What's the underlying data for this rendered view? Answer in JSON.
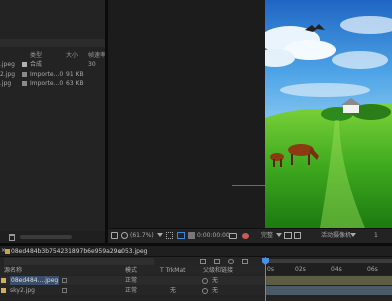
{
  "project": {
    "columns": {
      "type": "类型",
      "size": "大小",
      "depth": "帧速率"
    },
    "items": [
      {
        "name": ".jpeg",
        "type": "合成",
        "size": "",
        "depth": "30"
      },
      {
        "name": "2.jpg",
        "type": "Importe...0",
        "size": "91 KB",
        "depth": ""
      },
      {
        "name": ".jpg",
        "type": "Importe...0",
        "size": "63 KB",
        "depth": ""
      }
    ]
  },
  "viewer": {
    "zoom": "(61.7%)",
    "timecode": "0:00:00:00",
    "quality": "完整",
    "camera": "活动摄像机"
  },
  "timeline": {
    "tab_label": "08ed484b3b754231897b6e959a29e053.jpeg",
    "tab_close": "≡",
    "columns": {
      "name": "源名称",
      "mode": "模式",
      "trkmat": "T  TrkMat",
      "parent": "父级和链接"
    },
    "layers": [
      {
        "name": "08ed484....jpeg",
        "mode": "正常",
        "trkmat": "",
        "parent": "无"
      },
      {
        "name": "sky2.jpg",
        "mode": "正常",
        "trkmat": "无",
        "parent": "无"
      }
    ],
    "ruler": [
      "0s",
      "02s",
      "04s",
      "06s"
    ]
  }
}
